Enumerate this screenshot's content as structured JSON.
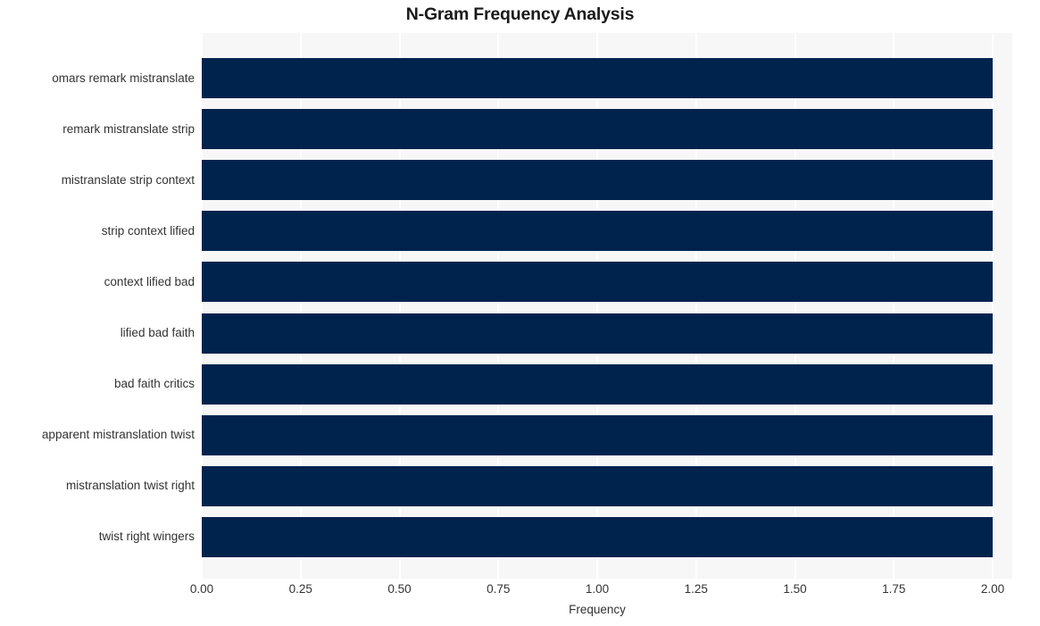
{
  "chart_data": {
    "type": "bar",
    "orientation": "horizontal",
    "title": "N-Gram Frequency Analysis",
    "xlabel": "Frequency",
    "ylabel": "",
    "categories": [
      "omars remark mistranslate",
      "remark mistranslate strip",
      "mistranslate strip context",
      "strip context lified",
      "context lified bad",
      "lified bad faith",
      "bad faith critics",
      "apparent mistranslation twist",
      "mistranslation twist right",
      "twist right wingers"
    ],
    "values": [
      2,
      2,
      2,
      2,
      2,
      2,
      2,
      2,
      2,
      2
    ],
    "xlim": [
      0.0,
      2.0
    ],
    "xticks": [
      "0.00",
      "0.25",
      "0.50",
      "0.75",
      "1.00",
      "1.25",
      "1.50",
      "1.75",
      "2.00"
    ],
    "xtick_values": [
      0.0,
      0.25,
      0.5,
      0.75,
      1.0,
      1.25,
      1.5,
      1.75,
      2.0
    ],
    "grid": true,
    "grid_axis": "x",
    "legend": "none",
    "colors": {
      "bar": "#00234e",
      "plot_background": "#f7f7f7",
      "gridline": "#ffffff",
      "figure_background": "#ffffff",
      "title_text": "#1a1a1a",
      "tick_text": "#333333"
    }
  }
}
